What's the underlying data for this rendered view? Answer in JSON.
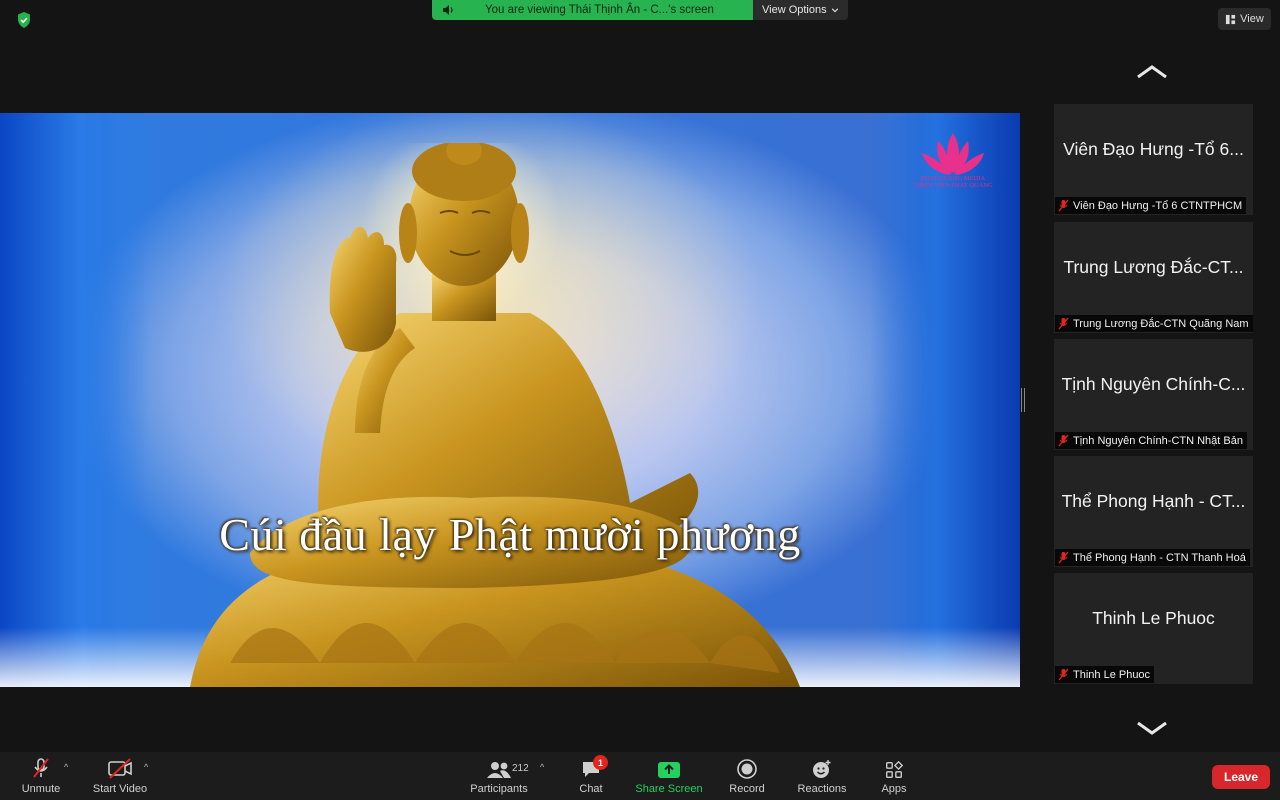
{
  "banner": {
    "text": "You are viewing Thái Thịnh Ân - C...'s screen",
    "view_options": "View Options"
  },
  "view_button": "View",
  "shared_screen": {
    "caption": "Cúi đầu lạy Phật mười phương",
    "logo_text_line1": "PHAT QUANG MEDIA",
    "logo_text_line2": "THIEN VIEN PHAT QUANG"
  },
  "gallery": {
    "tiles": [
      {
        "display": "Viên Đạo Hưng -Tổ 6...",
        "name": "Viên Đạo Hưng -Tổ 6 CTNTPHCM",
        "muted": true
      },
      {
        "display": "Trung Lương Đắc-CT...",
        "name": "Trung Lương Đắc-CTN Quãng Nam",
        "muted": true
      },
      {
        "display": "Tịnh Nguyên Chính-C...",
        "name": "Tịnh Nguyên Chính-CTN Nhật Bản",
        "muted": true
      },
      {
        "display": "Thể Phong Hạnh - CT...",
        "name": "Thể Phong Hạnh - CTN Thanh Hoá",
        "muted": true
      },
      {
        "display": "Thinh Le Phuoc",
        "name": "Thinh Le Phuoc",
        "muted": true
      }
    ]
  },
  "toolbar": {
    "unmute": "Unmute",
    "start_video": "Start Video",
    "participants": "Participants",
    "participants_count": "212",
    "chat": "Chat",
    "chat_badge": "1",
    "share_screen": "Share Screen",
    "record": "Record",
    "reactions": "Reactions",
    "apps": "Apps",
    "leave": "Leave"
  },
  "colors": {
    "share_green": "#27b350",
    "leave_red": "#d8272c",
    "badge_red": "#e0261d",
    "share_label_green": "#23d160"
  }
}
